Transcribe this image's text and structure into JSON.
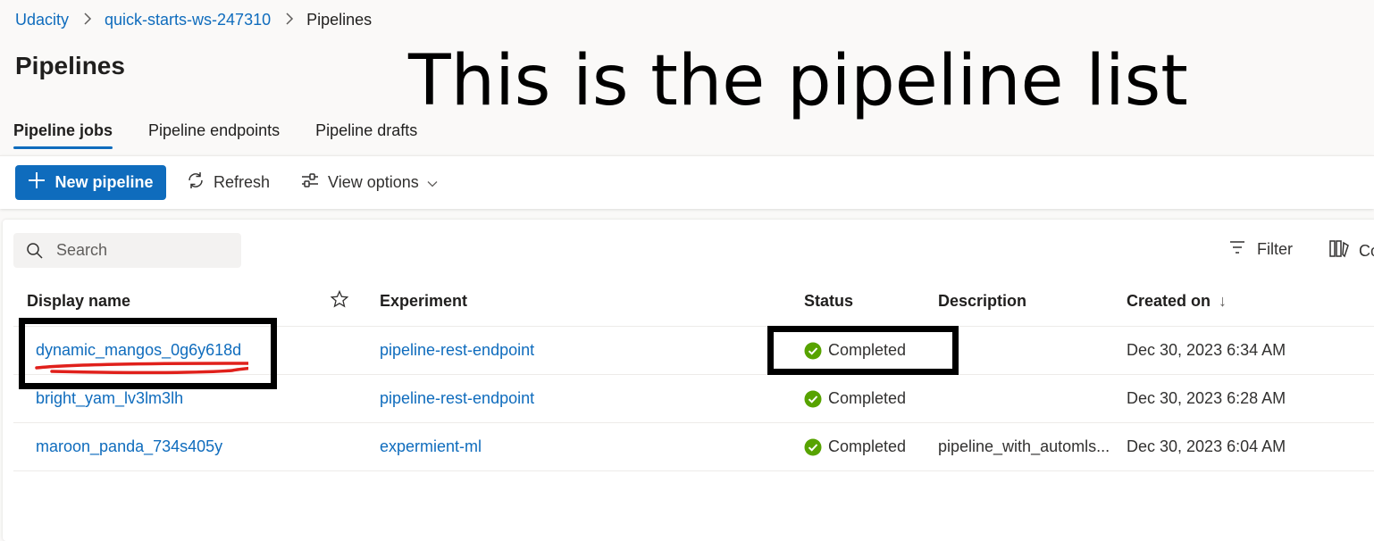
{
  "breadcrumb": {
    "items": [
      "Udacity",
      "quick-starts-ws-247310",
      "Pipelines"
    ],
    "separator": ">"
  },
  "page": {
    "title": "Pipelines"
  },
  "annotation": {
    "text": "This is the pipeline list"
  },
  "tabs": [
    {
      "label": "Pipeline jobs",
      "active": true
    },
    {
      "label": "Pipeline endpoints",
      "active": false
    },
    {
      "label": "Pipeline drafts",
      "active": false
    }
  ],
  "toolbar": {
    "new_label": "New pipeline",
    "refresh_label": "Refresh",
    "view_options_label": "View options"
  },
  "search": {
    "placeholder": "Search"
  },
  "filter": {
    "label": "Filter"
  },
  "columns": {
    "label": "Co"
  },
  "table": {
    "headers": {
      "display_name": "Display name",
      "experiment": "Experiment",
      "status": "Status",
      "description": "Description",
      "created_on": "Created on"
    },
    "sort_indicator": "↓",
    "rows": [
      {
        "name": "dynamic_mangos_0g6y618d",
        "experiment": "pipeline-rest-endpoint",
        "status": "Completed",
        "description": "",
        "created_on": "Dec 30, 2023 6:34 AM"
      },
      {
        "name": "bright_yam_lv3lm3lh",
        "experiment": "pipeline-rest-endpoint",
        "status": "Completed",
        "description": "",
        "created_on": "Dec 30, 2023 6:28 AM"
      },
      {
        "name": "maroon_panda_734s405y",
        "experiment": "expermient-ml",
        "status": "Completed",
        "description": "pipeline_with_automls...",
        "created_on": "Dec 30, 2023 6:04 AM"
      }
    ]
  },
  "colors": {
    "accent": "#0f6cbd",
    "success": "#57a300",
    "annotation_red": "#e0201b",
    "annotation_black": "#000000"
  }
}
